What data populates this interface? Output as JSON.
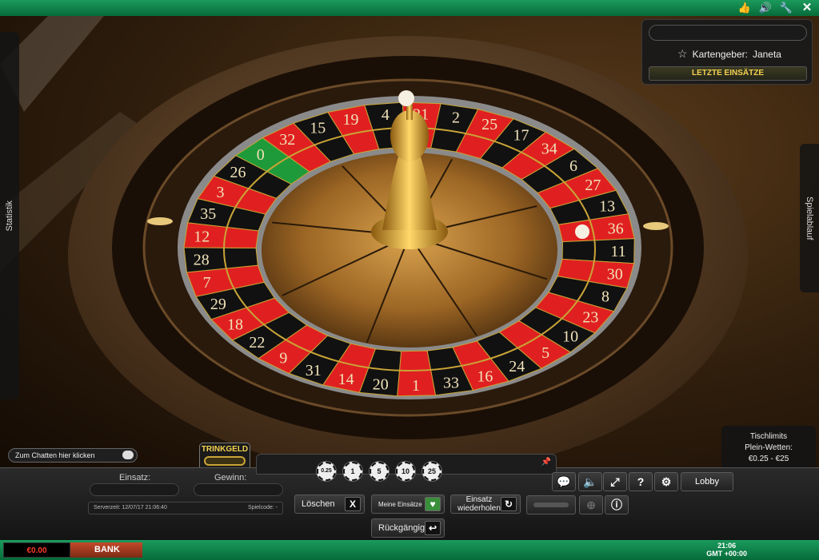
{
  "top_bar": {
    "icons": [
      "thumbs-up-icon",
      "speaker-icon",
      "wrench-icon",
      "close-icon"
    ]
  },
  "stage": {
    "left_tab": "Statistik",
    "right_tab": "Spielablauf",
    "dealer_label": "Kartengeber:",
    "dealer_name": "Janeta",
    "last_bets_button": "LETZTE EINSÄTZE",
    "chat_placeholder": "Zum Chatten hier klicken",
    "tip_label": "TRINKGELD",
    "limits": {
      "title": "Tischlimits",
      "subtitle": "Plein-Wetten:",
      "range": "€0.25 - €25"
    },
    "wheel_numbers": [
      "0",
      "32",
      "15",
      "19",
      "4",
      "21",
      "2",
      "25",
      "17",
      "34",
      "6",
      "27",
      "13",
      "36",
      "11",
      "30",
      "8",
      "23",
      "10",
      "5",
      "24",
      "16",
      "33",
      "1",
      "20",
      "14",
      "31",
      "9",
      "22",
      "18",
      "29",
      "7",
      "28",
      "12",
      "35",
      "3",
      "26"
    ]
  },
  "panel": {
    "chips": [
      "0.25",
      "1",
      "5",
      "10",
      "25"
    ],
    "stake_label": "Einsatz:",
    "win_label": "Gewinn:",
    "server_time": "Serverzeit: 12/07/17 21:06:40",
    "game_code": "Spielcode: -",
    "clear_button": "Löschen",
    "my_bets_button": "Meine Einsätze",
    "repeat_line1": "Einsatz",
    "repeat_line2": "wiederholen",
    "undo_button": "Rückgängig",
    "lobby_button": "Lobby"
  },
  "bottom_bar": {
    "balance": "€0.00",
    "bank_label": "BANK",
    "time": "21:06",
    "timezone": "GMT +00:00"
  },
  "colors": {
    "accent_green": "#0f8a4c",
    "gold": "#f3d251",
    "wheel_red": "#e02020"
  }
}
